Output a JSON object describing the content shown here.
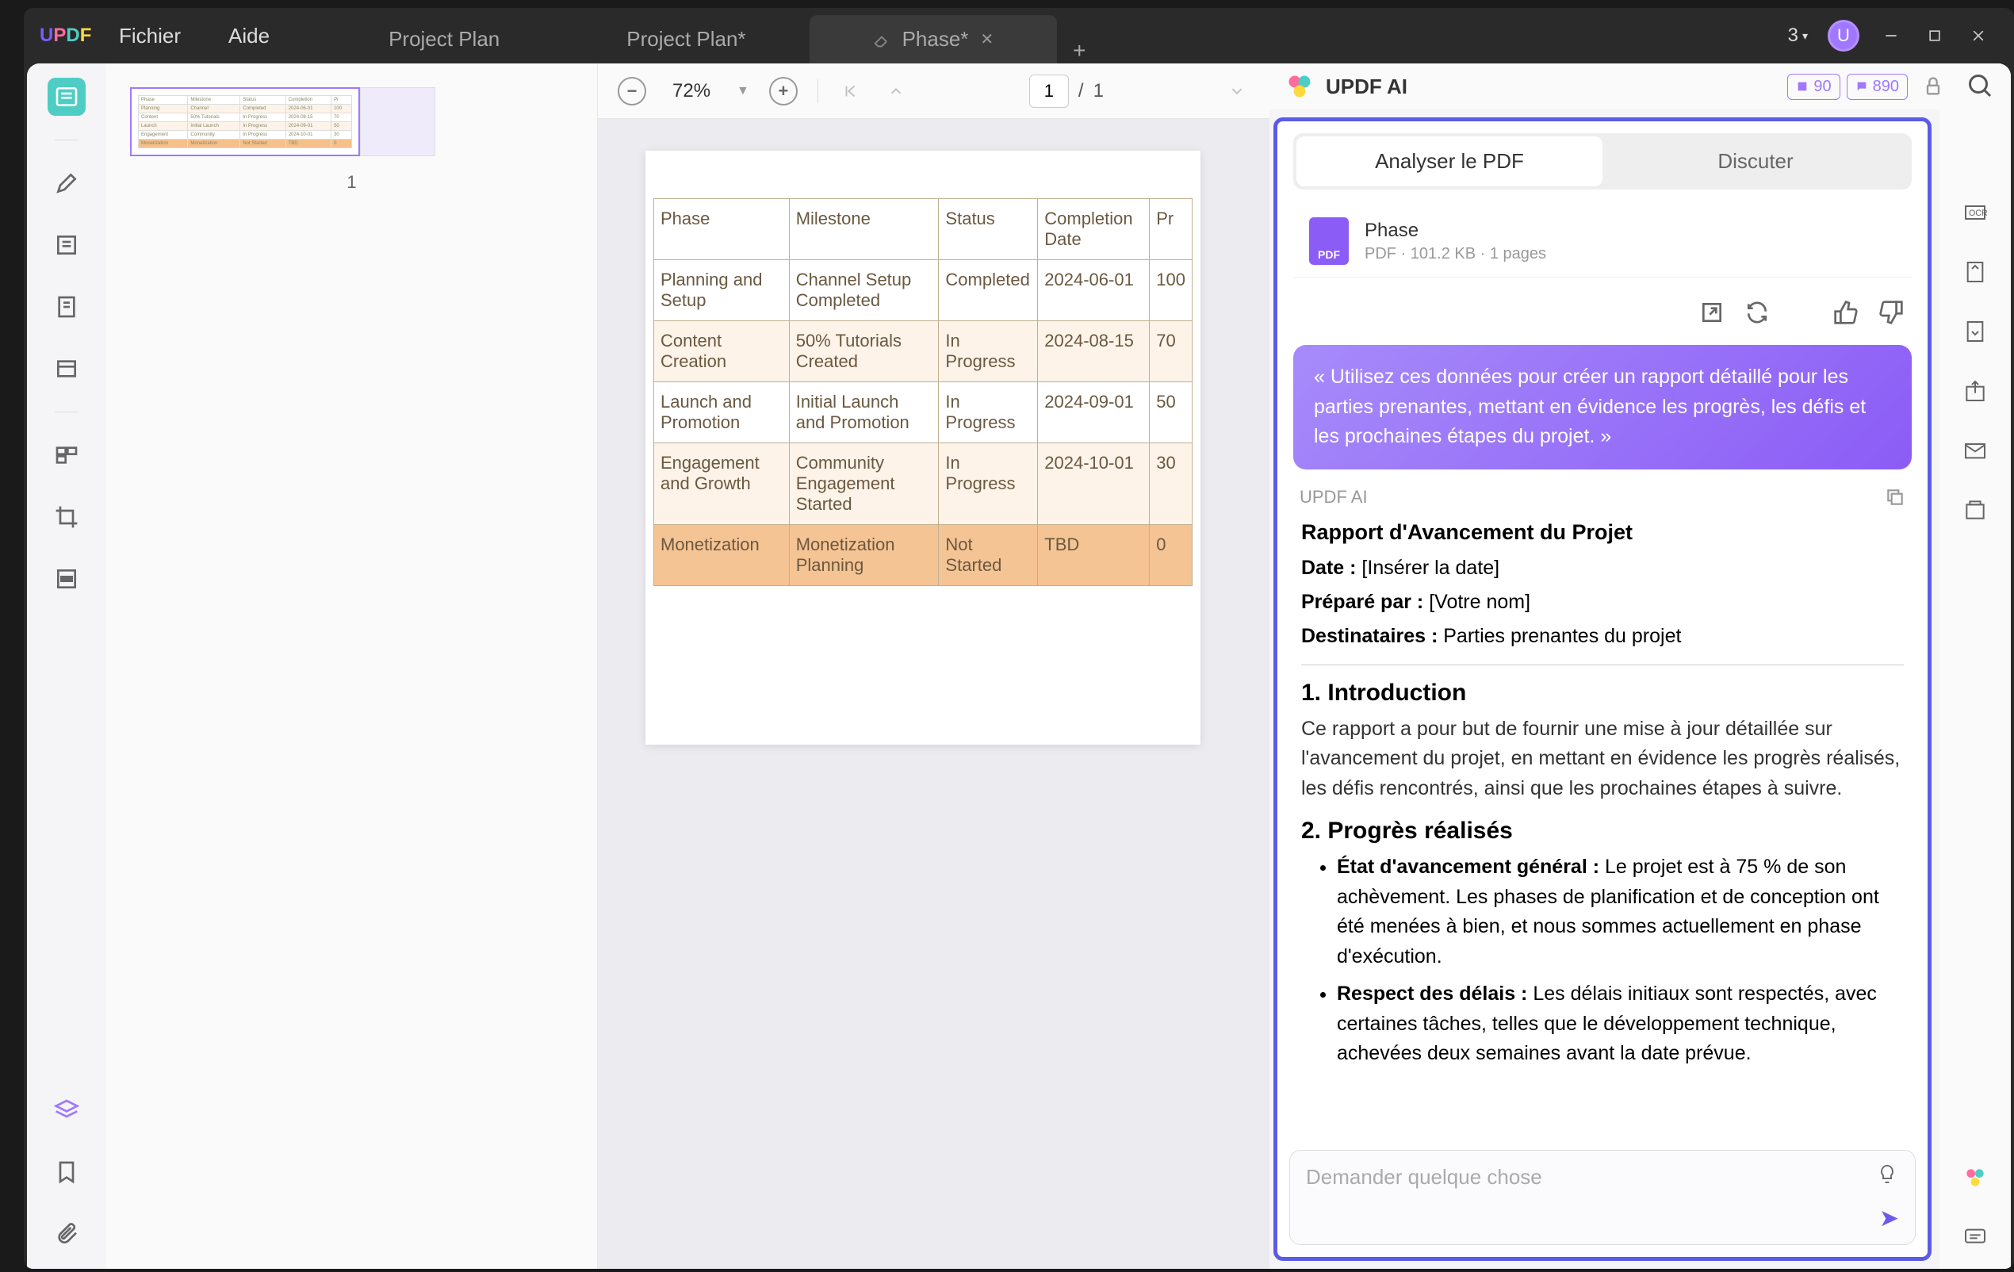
{
  "app": {
    "logo_u": "U",
    "logo_p": "P",
    "logo_d": "D",
    "logo_f": "F"
  },
  "menu": {
    "file": "Fichier",
    "help": "Aide"
  },
  "tabs": [
    {
      "label": "Project Plan"
    },
    {
      "label": "Project Plan*"
    },
    {
      "label": "Phase*"
    }
  ],
  "window": {
    "count": "3",
    "avatar": "U"
  },
  "zoom": {
    "value": "72%"
  },
  "page": {
    "current": "1",
    "sep": "/",
    "total": "1"
  },
  "thumb": {
    "num": "1"
  },
  "table": {
    "headers": [
      "Phase",
      "Milestone",
      "Status",
      "Completion Date",
      "Pr"
    ],
    "rows": [
      [
        "Planning and Setup",
        "Channel Setup Completed",
        "Completed",
        "2024-06-01",
        "100"
      ],
      [
        "Content Creation",
        "50% Tutorials Created",
        "In Progress",
        "2024-08-15",
        "70"
      ],
      [
        "Launch and Promotion",
        "Initial Launch and Promotion",
        "In Progress",
        "2024-09-01",
        "50"
      ],
      [
        "Engagement and Growth",
        "Community Engagement Started",
        "In Progress",
        "2024-10-01",
        "30"
      ],
      [
        "Monetization",
        "Monetization Planning",
        "Not Started",
        "TBD",
        "0"
      ]
    ]
  },
  "ai": {
    "title": "UPDF AI",
    "badge1": "90",
    "badge2": "890",
    "tab_analyze": "Analyser le PDF",
    "tab_chat": "Discuter",
    "file": {
      "name": "Phase",
      "meta": "PDF · 101.2 KB · 1 pages",
      "icon_label": "PDF"
    },
    "prompt": "« Utilisez ces données pour créer un rapport détaillé pour les parties prenantes, mettant en évidence les progrès, les défis et les prochaines étapes du projet. »",
    "label": "UPDF AI",
    "response": {
      "title": "Rapport d'Avancement du Projet",
      "date_label": "Date :",
      "date_val": "[Insérer la date]",
      "prep_label": "Préparé par :",
      "prep_val": "[Votre nom]",
      "dest_label": "Destinataires :",
      "dest_val": "Parties prenantes du projet",
      "h1": "1. Introduction",
      "p1": "Ce rapport a pour but de fournir une mise à jour détaillée sur l'avancement du projet, en mettant en évidence les progrès réalisés, les défis rencontrés, ainsi que les prochaines étapes à suivre.",
      "h2": "2. Progrès réalisés",
      "b1_label": "État d'avancement général :",
      "b1_text": " Le projet est à 75 % de son achèvement. Les phases de planification et de conception ont été menées à bien, et nous sommes actuellement en phase d'exécution.",
      "b2_label": "Respect des délais :",
      "b2_text": " Les délais initiaux sont respectés, avec certaines tâches, telles que le développement technique, achevées deux semaines avant la date prévue."
    },
    "input_placeholder": "Demander quelque chose"
  }
}
